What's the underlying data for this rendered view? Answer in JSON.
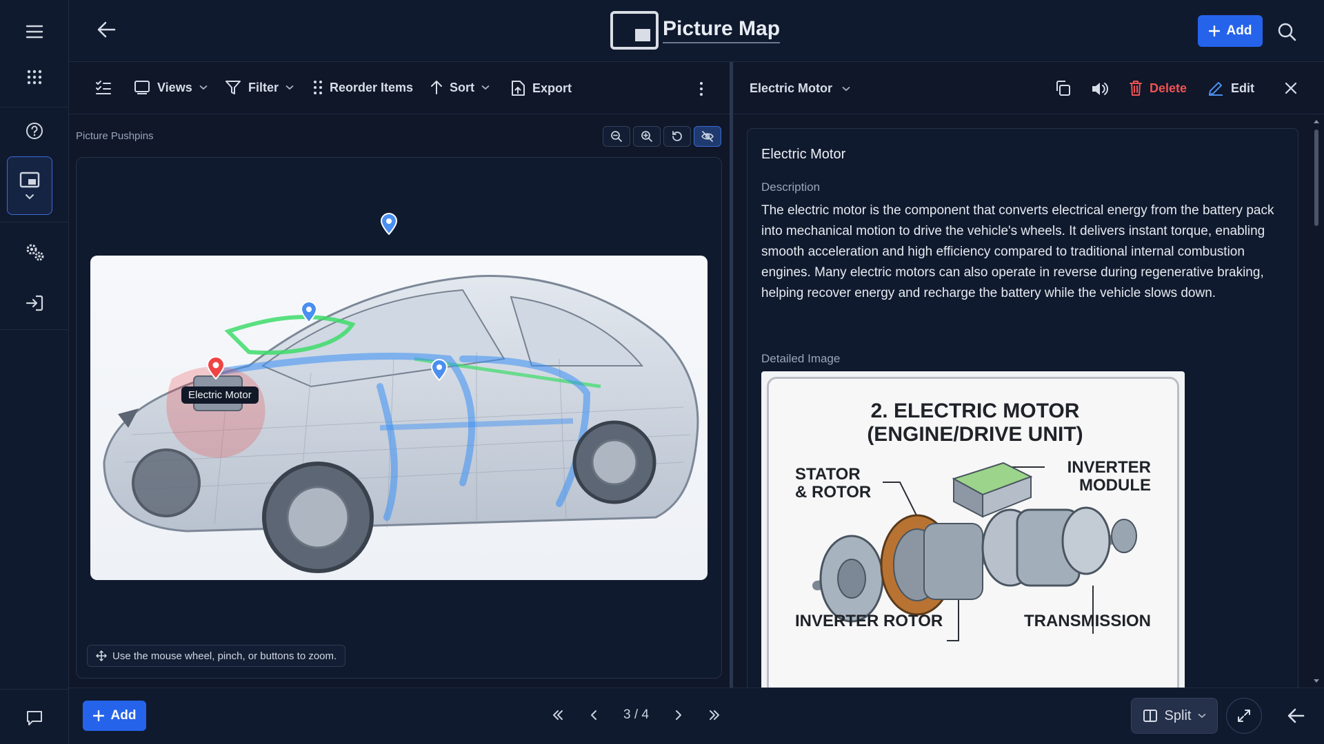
{
  "header": {
    "title": "Picture Map",
    "add_label": "Add"
  },
  "toolbar": {
    "views": "Views",
    "filter": "Filter",
    "reorder": "Reorder Items",
    "sort": "Sort",
    "export": "Export"
  },
  "map": {
    "panel_label": "Picture Pushpins",
    "active_pin_label": "Electric Motor",
    "hint": "Use the mouse wheel, pinch, or buttons to zoom."
  },
  "detail": {
    "selected_item": "Electric Motor",
    "delete_label": "Delete",
    "edit_label": "Edit",
    "title": "Electric Motor",
    "description_label": "Description",
    "description": "The electric motor is the component that converts electrical energy from the battery pack into mechanical motion to drive the vehicle's wheels. It delivers instant torque, enabling smooth acceleration and high efficiency compared to traditional internal combustion engines. Many electric motors can also operate in reverse during regenerative braking, helping recover energy and recharge the battery while the vehicle slows down.",
    "image_label": "Detailed Image",
    "diagram": {
      "title_line1": "2. ELECTRIC MOTOR",
      "title_line2": "(ENGINE/DRIVE UNIT)",
      "label_stator1": "STATOR",
      "label_stator2": "& ROTOR",
      "label_inverter1": "INVERTER",
      "label_inverter2": "MODULE",
      "label_rotor": "INVERTER ROTOR",
      "label_transmission": "TRANSMISSION"
    }
  },
  "footer": {
    "add_label": "Add",
    "page": "3 / 4",
    "split_label": "Split"
  },
  "colors": {
    "accent": "#2563eb",
    "delete": "#f05252",
    "pin_blue": "#4a8ff0",
    "pin_red": "#ef4444"
  }
}
